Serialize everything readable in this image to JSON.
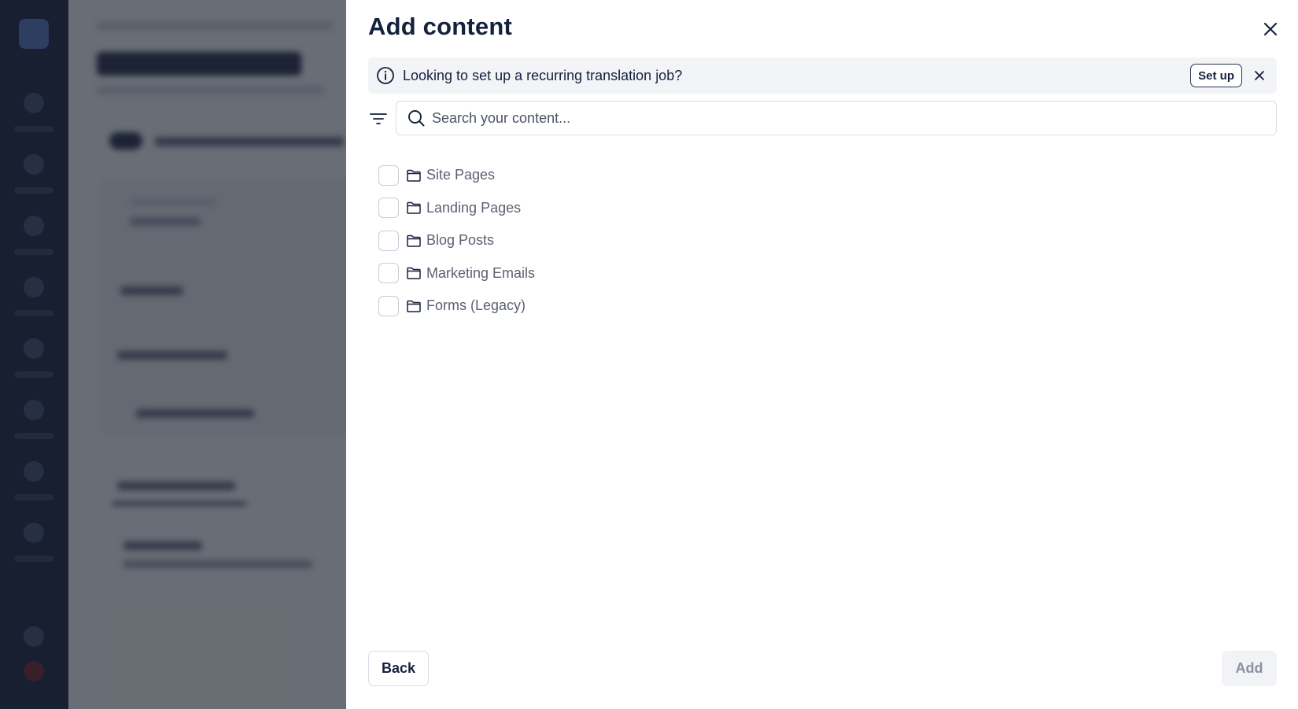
{
  "panel": {
    "title": "Add content",
    "banner": {
      "text": "Looking to set up a recurring translation job?",
      "setup_label": "Set up"
    },
    "search": {
      "placeholder": "Search your content..."
    },
    "items": [
      {
        "label": "Site Pages"
      },
      {
        "label": "Landing Pages"
      },
      {
        "label": "Blog Posts"
      },
      {
        "label": "Marketing Emails"
      },
      {
        "label": "Forms (Legacy)"
      }
    ],
    "footer": {
      "back_label": "Back",
      "add_label": "Add"
    },
    "icons": {
      "close": "close-icon",
      "info": "info-icon",
      "dismiss": "close-icon",
      "filter": "filter-icon",
      "search": "search-icon",
      "folder": "folder-icon"
    }
  },
  "colors": {
    "title": "#16213e",
    "banner_bg": "#f2f4f7",
    "overlay": "#141923",
    "disabled_button_bg": "#f1f3f6",
    "disabled_button_text": "#8a90a0"
  }
}
